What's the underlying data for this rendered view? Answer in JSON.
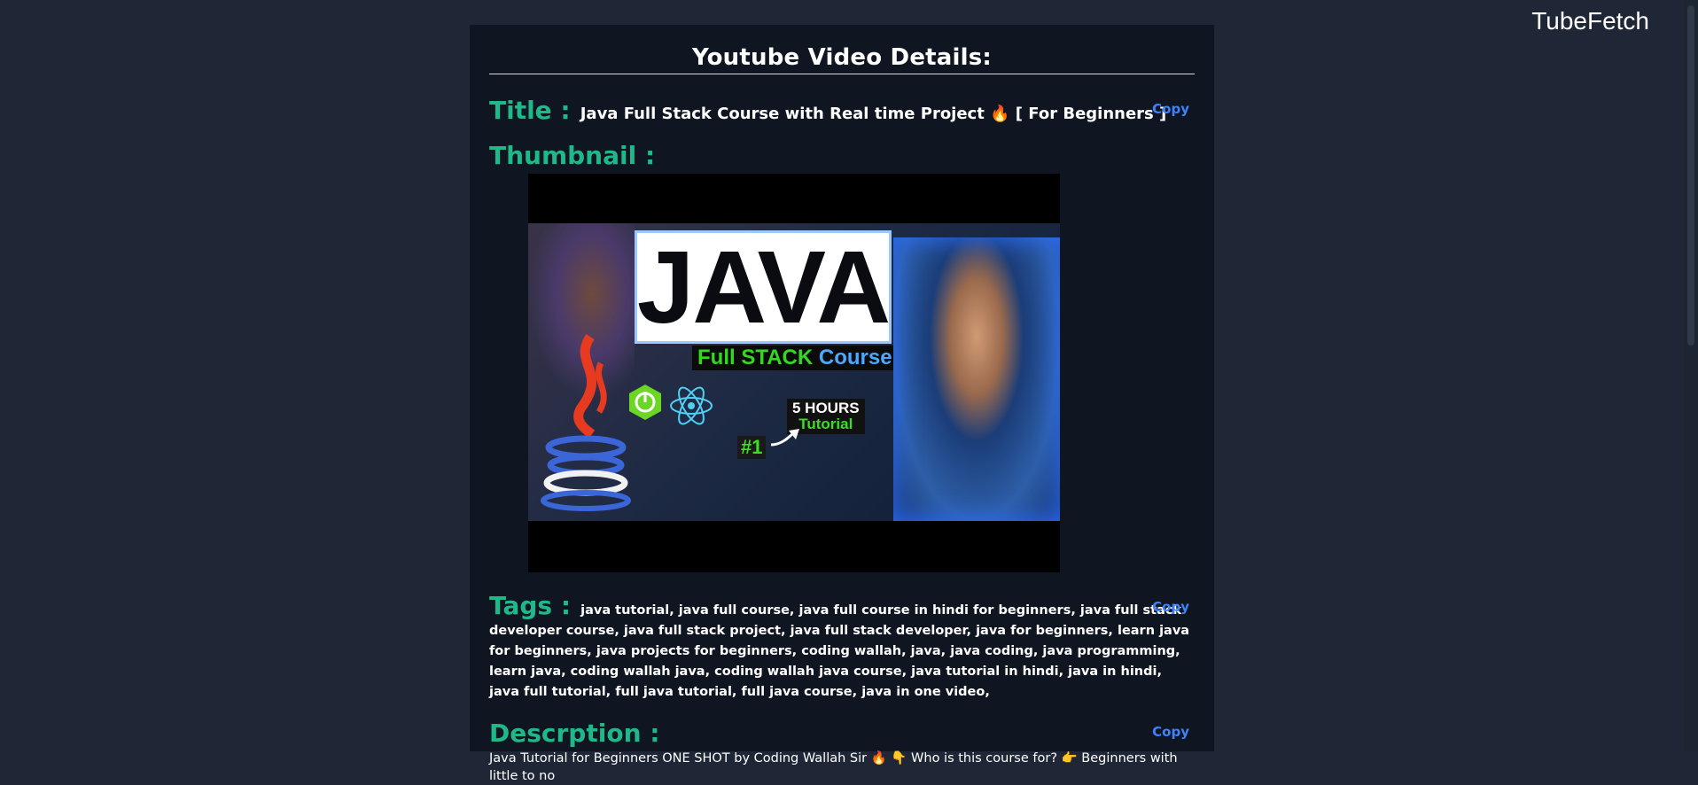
{
  "brand": "TubeFetch",
  "heading": "Youtube Video Details:",
  "title": {
    "label": "Title :",
    "value": "Java Full Stack Course with Real time Project 🔥 [ For Beginners ]",
    "copy": "Copy"
  },
  "thumbnail": {
    "label": "Thumbnail :",
    "big_text": "JAVA",
    "subtitle_green": "Full STACK",
    "subtitle_blue": "Course",
    "hours_line1": "5 HOURS",
    "hours_line2": "Tutorial",
    "rank": "#1"
  },
  "tags": {
    "label": "Tags :",
    "value": "java tutorial, java full course, java full course in hindi for beginners, java full stack developer course, java full stack project, java full stack developer, java for beginners, learn java for beginners, java projects for beginners, coding wallah, java, java coding, java programming, learn java, coding wallah java, coding wallah java course, java tutorial in hindi, java in hindi, java full tutorial, full java tutorial, full java course, java in one video,",
    "copy": "Copy"
  },
  "description": {
    "label": "Descrption :",
    "value": "Java Tutorial for Beginners ONE SHOT by Coding Wallah Sir 🔥 👇 Who is this course for? 👉 Beginners with little to no",
    "copy": "Copy"
  },
  "colors": {
    "background": "#1f2736",
    "panel": "#0f1521",
    "label": "#20b888",
    "link": "#3f83f8"
  }
}
